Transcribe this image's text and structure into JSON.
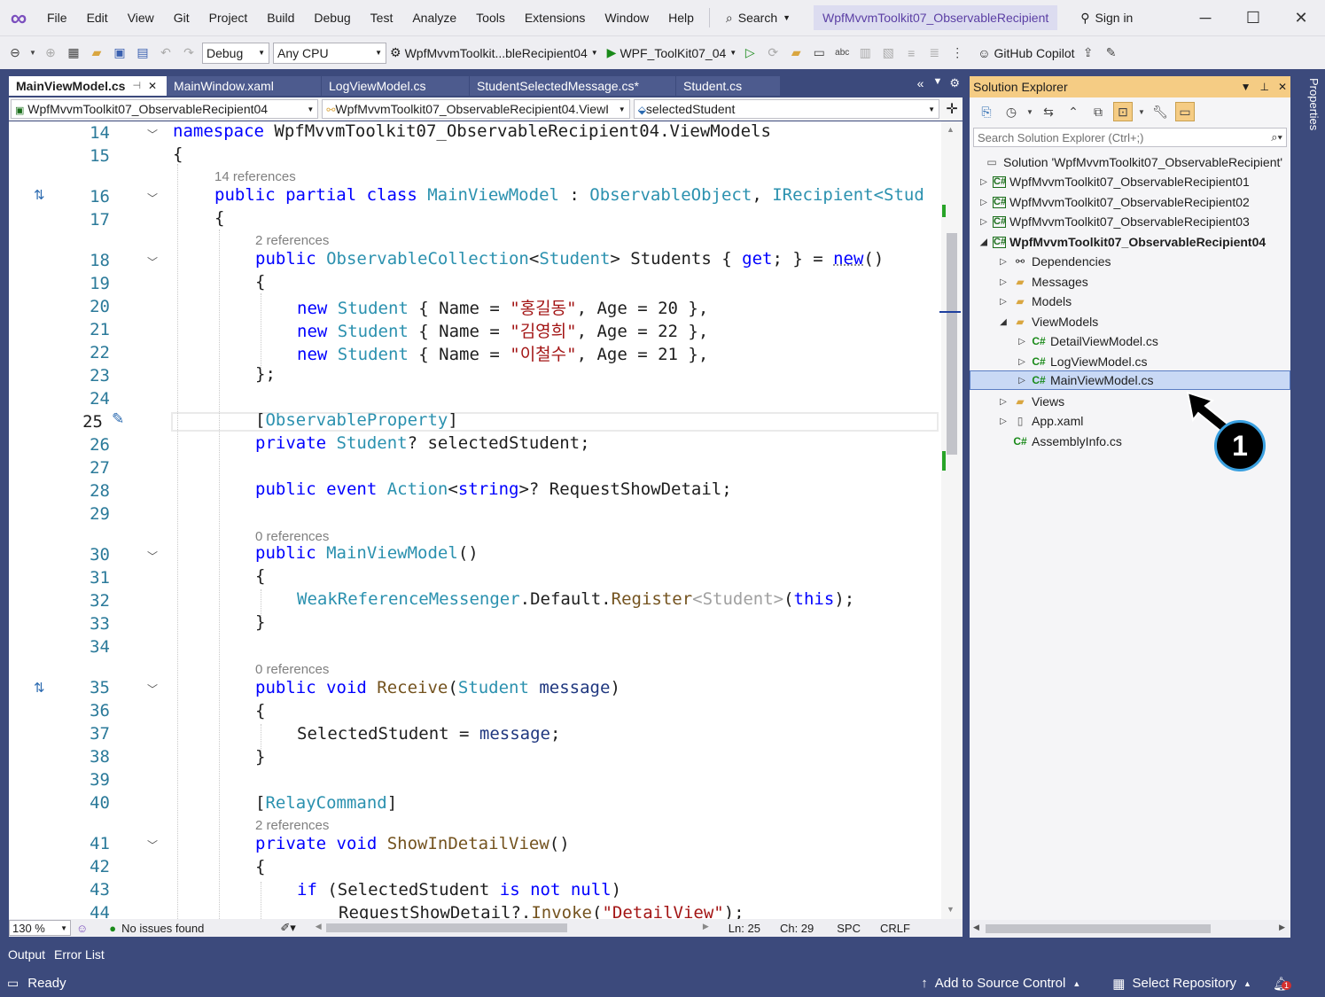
{
  "menu": {
    "items": [
      "File",
      "Edit",
      "View",
      "Git",
      "Project",
      "Build",
      "Debug",
      "Test",
      "Analyze",
      "Tools",
      "Extensions",
      "Window",
      "Help"
    ],
    "search_label": "Search",
    "solution_title": "WpfMvvmToolkit07_ObservableRecipient",
    "sign_in": "Sign in"
  },
  "toolbar": {
    "config": "Debug",
    "platform": "Any CPU",
    "startup_project": "WpfMvvmToolkit...bleRecipient04",
    "run_target": "WPF_ToolKit07_04",
    "copilot": "GitHub Copilot"
  },
  "tabs": [
    {
      "label": "MainViewModel.cs",
      "active": true
    },
    {
      "label": "MainWindow.xaml",
      "active": false
    },
    {
      "label": "LogViewModel.cs",
      "active": false
    },
    {
      "label": "StudentSelectedMessage.cs*",
      "active": false
    },
    {
      "label": "Student.cs",
      "active": false
    }
  ],
  "navbar": {
    "project": "WpfMvvmToolkit07_ObservableRecipient04",
    "class": "WpfMvvmToolkit07_ObservableRecipient04.ViewI",
    "member": "selectedStudent"
  },
  "code": {
    "refs_14": "14 references",
    "refs_2a": "2 references",
    "refs_0a": "0 references",
    "refs_0b": "0 references",
    "refs_2b": "2 references",
    "ns_kw": "namespace",
    "ns_name": " WpfMvvmToolkit07_ObservableRecipient04.ViewModels",
    "open": "{",
    "close": "}",
    "close_semi": "};",
    "class_kw": "public partial class",
    "class_name": "MainViewModel",
    "colon": " : ",
    "base1": "ObservableObject",
    "comma": ", ",
    "base2": "IRecipient",
    "base2_rest": "<Stud",
    "coll_kw": "public",
    "coll_type": "ObservableCollection",
    "coll_gen": "Student",
    "coll_rest": "> Students { ",
    "coll_get": "get",
    "coll_rest2": "; } = ",
    "coll_new": "new",
    "coll_end": "()",
    "new_kw": "new",
    "student_ty": "Student",
    "name_mid": " { Name = ",
    "s1": "\"홍길동\"",
    "s2": "\"김영희\"",
    "s3": "\"이철수\"",
    "age_a": ", Age = 20 },",
    "age_b": ", Age = 22 },",
    "age_c": ", Age = 21 },",
    "attr1_open": "[",
    "attr1": "ObservableProperty",
    "attr1_close": "]",
    "priv_kw": "private",
    "priv_ty": "Student",
    "priv_rest": "? selectedStudent;",
    "ev_kw": "public event",
    "ev_ty": "Action",
    "ev_str_kw": "string",
    "ev_rest": ">? RequestShowDetail;",
    "ctor_kw": "public",
    "ctor_name": "MainViewModel",
    "ctor_end": "()",
    "wrm": "WeakReferenceMessenger",
    "wrm_mid": ".Default.",
    "wrm_fn": "Register",
    "wrm_gen": "<Student>",
    "wrm_open": "(",
    "wrm_this": "this",
    "wrm_end": ");",
    "recv_kw": "public void",
    "recv_fn": "Receive",
    "recv_ty": "Student",
    "recv_prm": "message",
    "sel_assign": "SelectedStudent = ",
    "sel_prm": "message",
    "semi": ";",
    "attr2": "RelayCommand",
    "show_kw": "private void",
    "show_fn": "ShowInDetailView",
    "if_kw": "if",
    "if_mid": " (SelectedStudent ",
    "is_kw": "is not null",
    "paren_close": ")",
    "req_name": "RequestShowDetail?.",
    "req_fn": "Invoke",
    "req_str": "\"DetailView\"",
    "lines": [
      "14",
      "15",
      "16",
      "17",
      "18",
      "19",
      "20",
      "21",
      "22",
      "23",
      "24",
      "25",
      "26",
      "27",
      "28",
      "29",
      "30",
      "31",
      "32",
      "33",
      "34",
      "35",
      "36",
      "37",
      "38",
      "39",
      "40",
      "41",
      "42",
      "43",
      "44"
    ]
  },
  "editor_status": {
    "zoom": "130 %",
    "issues": "No issues found",
    "ln": "Ln: 25",
    "ch": "Ch: 29",
    "spc": "SPC",
    "crlf": "CRLF"
  },
  "bottom_tabs": [
    "Output",
    "Error List"
  ],
  "status": {
    "ready": "Ready",
    "source_control": "Add to Source Control",
    "repository": "Select Repository",
    "notif_count": "1"
  },
  "solution_explorer": {
    "title": "Solution Explorer",
    "search_placeholder": "Search Solution Explorer (Ctrl+;)",
    "tree": [
      {
        "label": "Solution 'WpfMvvmToolkit07_ObservableRecipient'",
        "icon": "solution-icon",
        "level": 0,
        "arrow": ""
      },
      {
        "label": "WpfMvvmToolkit07_ObservableRecipient01",
        "icon": "project-icon",
        "level": 0,
        "arrow": "right"
      },
      {
        "label": "WpfMvvmToolkit07_ObservableRecipient02",
        "icon": "project-icon",
        "level": 0,
        "arrow": "right"
      },
      {
        "label": "WpfMvvmToolkit07_ObservableRecipient03",
        "icon": "project-icon",
        "level": 0,
        "arrow": "right"
      },
      {
        "label": "WpfMvvmToolkit07_ObservableRecipient04",
        "icon": "project-icon",
        "level": 0,
        "arrow": "down",
        "bold": true
      },
      {
        "label": "Dependencies",
        "icon": "dependencies-icon",
        "level": 1,
        "arrow": "right"
      },
      {
        "label": "Messages",
        "icon": "folder-icon",
        "level": 1,
        "arrow": "right"
      },
      {
        "label": "Models",
        "icon": "folder-icon",
        "level": 1,
        "arrow": "right"
      },
      {
        "label": "ViewModels",
        "icon": "folder-icon",
        "level": 1,
        "arrow": "down"
      },
      {
        "label": "DetailViewModel.cs",
        "icon": "csharp-file-icon",
        "level": 2,
        "arrow": "right"
      },
      {
        "label": "LogViewModel.cs",
        "icon": "csharp-file-icon",
        "level": 2,
        "arrow": "right"
      },
      {
        "label": "MainViewModel.cs",
        "icon": "csharp-file-icon",
        "level": 2,
        "arrow": "right",
        "selected": true
      },
      {
        "label": "Views",
        "icon": "folder-icon",
        "level": 1,
        "arrow": "right"
      },
      {
        "label": "App.xaml",
        "icon": "xaml-file-icon",
        "level": 1,
        "arrow": "right"
      },
      {
        "label": "AssemblyInfo.cs",
        "icon": "csharp-file-icon",
        "level": 1,
        "arrow": ""
      }
    ]
  },
  "properties_tab": "Properties",
  "annotation": {
    "badge": "1"
  },
  "colors": {
    "accent": "#3c4a7c",
    "panel_title": "#f5cc84",
    "selection": "#c9d9f5",
    "keyword": "#0000ff",
    "type": "#2b91af",
    "string": "#a31515"
  }
}
